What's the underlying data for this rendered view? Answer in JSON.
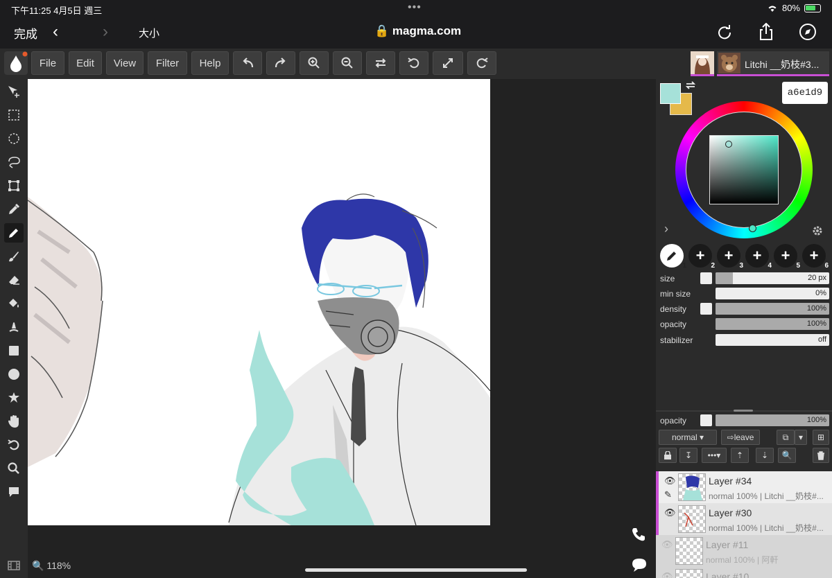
{
  "status": {
    "time": "下午11:25   4月5日 週三",
    "battery": "80%"
  },
  "safari": {
    "done": "完成",
    "text_size": "大小",
    "url": "magma.com"
  },
  "menu": {
    "file": "File",
    "edit": "Edit",
    "view": "View",
    "filter": "Filter",
    "help": "Help"
  },
  "user": {
    "name": "Litchi __奶枝#3..."
  },
  "color": {
    "hex": "a6e1d9",
    "primary": "#a6e1d9",
    "secondary": "#e5b94a"
  },
  "brush_slots": [
    "1",
    "2",
    "3",
    "4",
    "5",
    "6"
  ],
  "brush": {
    "size": {
      "label": "size",
      "value": "20 px",
      "fraction": 0.15
    },
    "min_size": {
      "label": "min size",
      "value": "0%"
    },
    "density": {
      "label": "density",
      "value": "100%",
      "fraction": 1
    },
    "opacity": {
      "label": "opacity",
      "value": "100%",
      "fraction": 1
    },
    "stabilizer": {
      "label": "stabilizer",
      "value": "off"
    }
  },
  "layer_opacity": {
    "label": "opacity",
    "value": "100%",
    "fraction": 1
  },
  "blend": {
    "mode": "normal",
    "leave": "leave"
  },
  "layers": [
    {
      "name": "Layer #34",
      "meta": "normal 100% | Litchi __奶枝#..."
    },
    {
      "name": "Layer #30",
      "meta": "normal 100% | Litchi __奶枝#..."
    },
    {
      "name": "Layer #11",
      "meta": "normal 100% | 阿軒"
    },
    {
      "name": "Layer #10",
      "meta": ""
    }
  ],
  "zoom": "118%"
}
